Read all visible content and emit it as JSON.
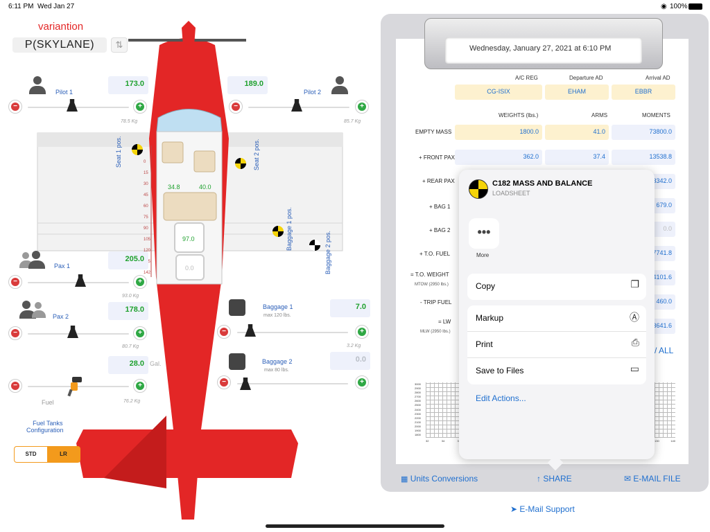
{
  "status": {
    "time": "6:11 PM",
    "date": "Wed Jan 27",
    "battery": "100%"
  },
  "header": {
    "variation_label": "variantion",
    "aircraft": "P(SKYLANE)"
  },
  "seats": {
    "pilot1": {
      "label": "Pilot 1",
      "value": "173.0",
      "kg": "78.5 Kg"
    },
    "pilot2": {
      "label": "Pilot 2",
      "value": "189.0",
      "kg": "85.7 Kg"
    },
    "pax1": {
      "label": "Pax 1",
      "value": "205.0",
      "kg": "93.0 Kg"
    },
    "pax2": {
      "label": "Pax 2",
      "value": "178.0",
      "kg": "80.7 Kg"
    }
  },
  "fuel": {
    "value": "28.0",
    "unit": "Gal.",
    "label": "Fuel",
    "kg": "76.2 Kg",
    "tanks_label_1": "Fuel Tanks",
    "tanks_label_2": "Configuration",
    "std": "STD",
    "lr": "LR"
  },
  "baggage1": {
    "label": "Baggage 1",
    "sub": "max 120 lbs.",
    "value": "7.0",
    "kg": "3.2 Kg"
  },
  "baggage2": {
    "label": "Baggage 2",
    "sub": "max 80 lbs.",
    "value": "0.0"
  },
  "plane": {
    "seat1_pos": "Seat 1 pos.",
    "seat2_pos": "Seat 2 pos.",
    "baggage1_pos": "Baggage 1 pos.",
    "baggage2_pos": "Baggage 2 pos.",
    "arm_left": "34.8",
    "arm_right": "40.0",
    "bag1_val": "97.0",
    "bag2_val": "0.0",
    "ruler": [
      "0",
      "15",
      "30",
      "45",
      "60",
      "75",
      "90",
      "105",
      "120",
      "135",
      "142"
    ]
  },
  "ticket": {
    "date": "Wednesday, January 27, 2021 at 6:10 PM",
    "hdr_reg": "A/C REG",
    "hdr_dep": "Departure AD",
    "hdr_arr": "Arrival AD",
    "reg": "CG-ISIX",
    "dep": "EHAM",
    "arr": "EBBR",
    "hdr_weights": "WEIGHTS (lbs.)",
    "hdr_arms": "ARMS",
    "hdr_moments": "MOMENTS",
    "rows": [
      {
        "label": "EMPTY MASS",
        "w": "1800.0",
        "a": "41.0",
        "m": "73800.0"
      },
      {
        "label": "+ FRONT PAX",
        "w": "362.0",
        "a": "37.4",
        "m": "13538.8"
      },
      {
        "label": "+ REAR PAX",
        "m": "3342.0"
      },
      {
        "label": "+ BAG 1",
        "m": "679.0"
      },
      {
        "label": "+ BAG 2",
        "m": "0.0"
      },
      {
        "label": "+ T.O. FUEL",
        "m": "7741.8"
      },
      {
        "label": "= T.O. WEIGHT",
        "sub": "MTOW (2950 lbs.)",
        "m": "4101.6"
      },
      {
        "label": "- TRIP FUEL",
        "m": "460.0"
      },
      {
        "label": "= LW",
        "sub": "MLW (2950 lbs.)",
        "m": "3641.6"
      }
    ],
    "all": "/ ALL",
    "chart_y": [
      "3000",
      "2900",
      "2800",
      "2700",
      "2600",
      "2500",
      "2400",
      "2300",
      "2200",
      "2100",
      "2000",
      "1900",
      "1800"
    ],
    "chart_x_left": [
      "32",
      "34",
      "36"
    ],
    "chart_x_right": [
      "130",
      "140"
    ]
  },
  "toolbar": {
    "units": "Units Conversions",
    "share": "SHARE",
    "email_file": "E-MAIL FILE",
    "support": "E-Mail Support"
  },
  "share_sheet": {
    "title": "C182 MASS AND BALANCE",
    "subtitle": "LOADSHEET",
    "more": "More",
    "copy": "Copy",
    "markup": "Markup",
    "print": "Print",
    "save": "Save to Files",
    "edit": "Edit Actions..."
  },
  "colors": {
    "accent": "#1f6fcf",
    "plane_red": "#e32626",
    "fuel_orange": "#f39a1c",
    "value_green": "#1fa12e"
  }
}
